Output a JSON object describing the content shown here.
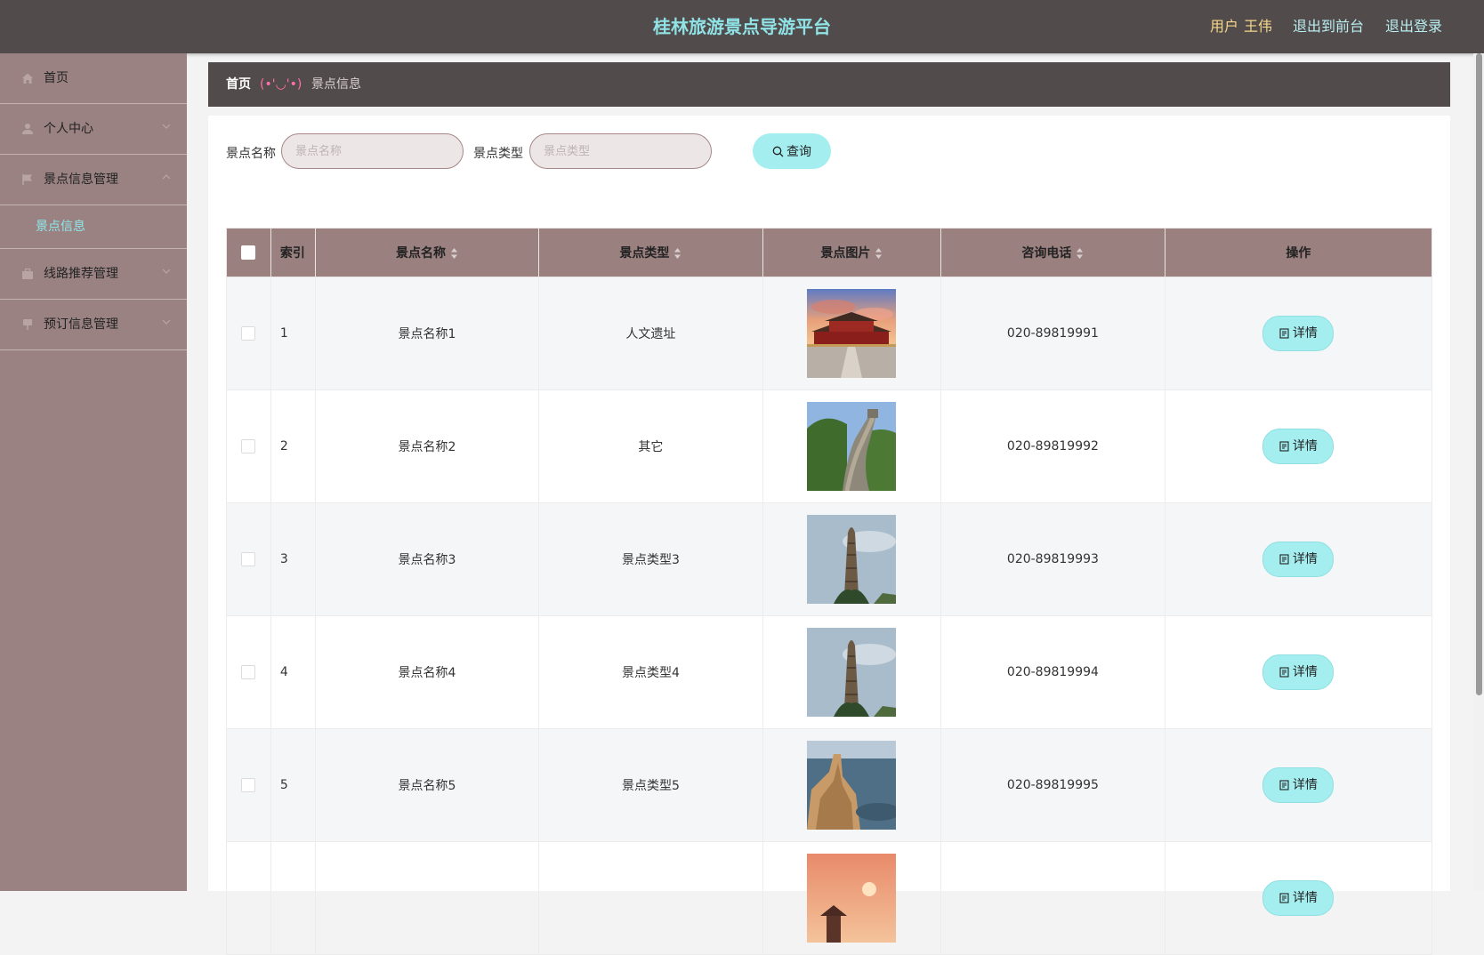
{
  "header": {
    "title": "桂林旅游景点导游平台",
    "user_label": "用户",
    "user_name": "王伟",
    "front_link": "退出到前台",
    "logout_link": "退出登录"
  },
  "sidebar": {
    "items": [
      {
        "label": "首页",
        "icon": "home-icon"
      },
      {
        "label": "个人中心",
        "icon": "user-icon"
      },
      {
        "label": "景点信息管理",
        "icon": "flag-icon",
        "expanded": true,
        "children": [
          {
            "label": "景点信息",
            "active": true
          }
        ]
      },
      {
        "label": "线路推荐管理",
        "icon": "briefcase-icon"
      },
      {
        "label": "预订信息管理",
        "icon": "pin-icon"
      }
    ]
  },
  "breadcrumb": {
    "home": "首页",
    "separator": "(•'◡'•)",
    "current": "景点信息"
  },
  "search": {
    "name_label": "景点名称",
    "name_placeholder": "景点名称",
    "type_label": "景点类型",
    "type_placeholder": "景点类型",
    "button_label": "查询"
  },
  "table": {
    "headers": {
      "index": "索引",
      "name": "景点名称",
      "type": "景点类型",
      "image": "景点图片",
      "phone": "咨询电话",
      "action": "操作"
    },
    "detail_label": "详情",
    "rows": [
      {
        "index": "1",
        "name": "景点名称1",
        "type": "人文遗址",
        "image": "gate-tower-photo",
        "phone": "020-89819991"
      },
      {
        "index": "2",
        "name": "景点名称2",
        "type": "其它",
        "image": "great-wall-photo",
        "phone": "020-89819992"
      },
      {
        "index": "3",
        "name": "景点名称3",
        "type": "景点类型3",
        "image": "stone-pillar-photo",
        "phone": "020-89819993"
      },
      {
        "index": "4",
        "name": "景点名称4",
        "type": "景点类型4",
        "image": "stone-pillar-photo",
        "phone": "020-89819994"
      },
      {
        "index": "5",
        "name": "景点名称5",
        "type": "景点类型5",
        "image": "sea-cliff-photo",
        "phone": "020-89819995"
      },
      {
        "index": "",
        "name": "",
        "type": "",
        "image": "sunset-pagoda-photo",
        "phone": ""
      }
    ]
  },
  "colors": {
    "topbar": "#524b4b",
    "sidebar": "#9a8282",
    "accent": "#a5eef0",
    "title": "#8fe3e6",
    "username": "#f4d88a",
    "table_header": "#9b8080"
  }
}
